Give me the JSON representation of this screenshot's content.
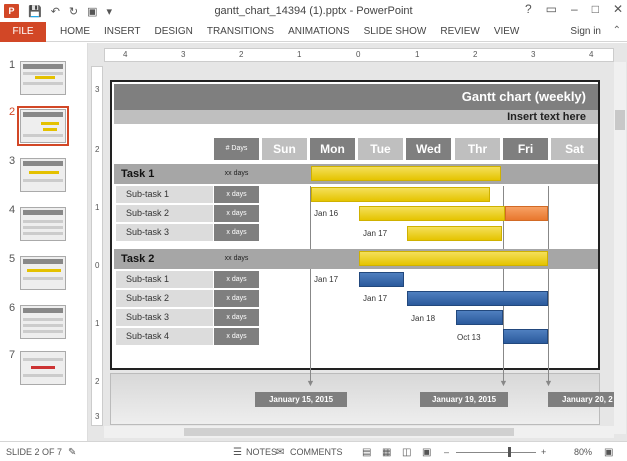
{
  "window": {
    "title": "gantt_chart_14394 (1).pptx - PowerPoint",
    "help": "?",
    "signin": "Sign in"
  },
  "ribbon": {
    "file": "FILE",
    "tabs": [
      "HOME",
      "INSERT",
      "DESIGN",
      "TRANSITIONS",
      "ANIMATIONS",
      "SLIDE SHOW",
      "REVIEW",
      "VIEW"
    ]
  },
  "thumbnails": [
    "1",
    "2",
    "3",
    "4",
    "5",
    "6",
    "7"
  ],
  "ruler": {
    "h": [
      "4",
      "3",
      "2",
      "1",
      "0",
      "1",
      "2",
      "3",
      "4"
    ],
    "v": [
      "3",
      "2",
      "1",
      "0",
      "1",
      "2",
      "3"
    ]
  },
  "slide": {
    "title": "Gantt chart (weekly)",
    "subtitle": "Insert text here",
    "days_header": "# Days",
    "day_names": [
      "Sun",
      "Mon",
      "Tue",
      "Wed",
      "Thr",
      "Fri",
      "Sat"
    ],
    "colors": {
      "dark": "#7f7f7f",
      "mid": "#a6a6a6",
      "light": "#bfbfbf",
      "yellow": "#e5c400",
      "orange": "#e8772e",
      "blue": "#2b5a9c"
    },
    "task1": {
      "name": "Task 1",
      "days": "xx days",
      "subtasks": [
        {
          "name": "Sub-task 1",
          "days": "x days",
          "date": ""
        },
        {
          "name": "Sub-task 2",
          "days": "x days",
          "date": "Jan 16"
        },
        {
          "name": "Sub-task 3",
          "days": "x days",
          "date": "Jan 17"
        }
      ]
    },
    "task2": {
      "name": "Task 2",
      "days": "xx days",
      "subtasks": [
        {
          "name": "Sub-task 1",
          "days": "x days",
          "date": "Jan 17"
        },
        {
          "name": "Sub-task 2",
          "days": "x days",
          "date": "Jan 17"
        },
        {
          "name": "Sub-task 3",
          "days": "x days",
          "date": "Jan 18"
        },
        {
          "name": "Sub-task 4",
          "days": "x days",
          "date": "Oct 13"
        }
      ]
    },
    "milestones": [
      "January 15, 2015",
      "January 19, 2015",
      "January 20, 2"
    ]
  },
  "status": {
    "slide": "SLIDE 2 OF 7",
    "notes": "NOTES",
    "comments": "COMMENTS",
    "zoom": "80%"
  }
}
